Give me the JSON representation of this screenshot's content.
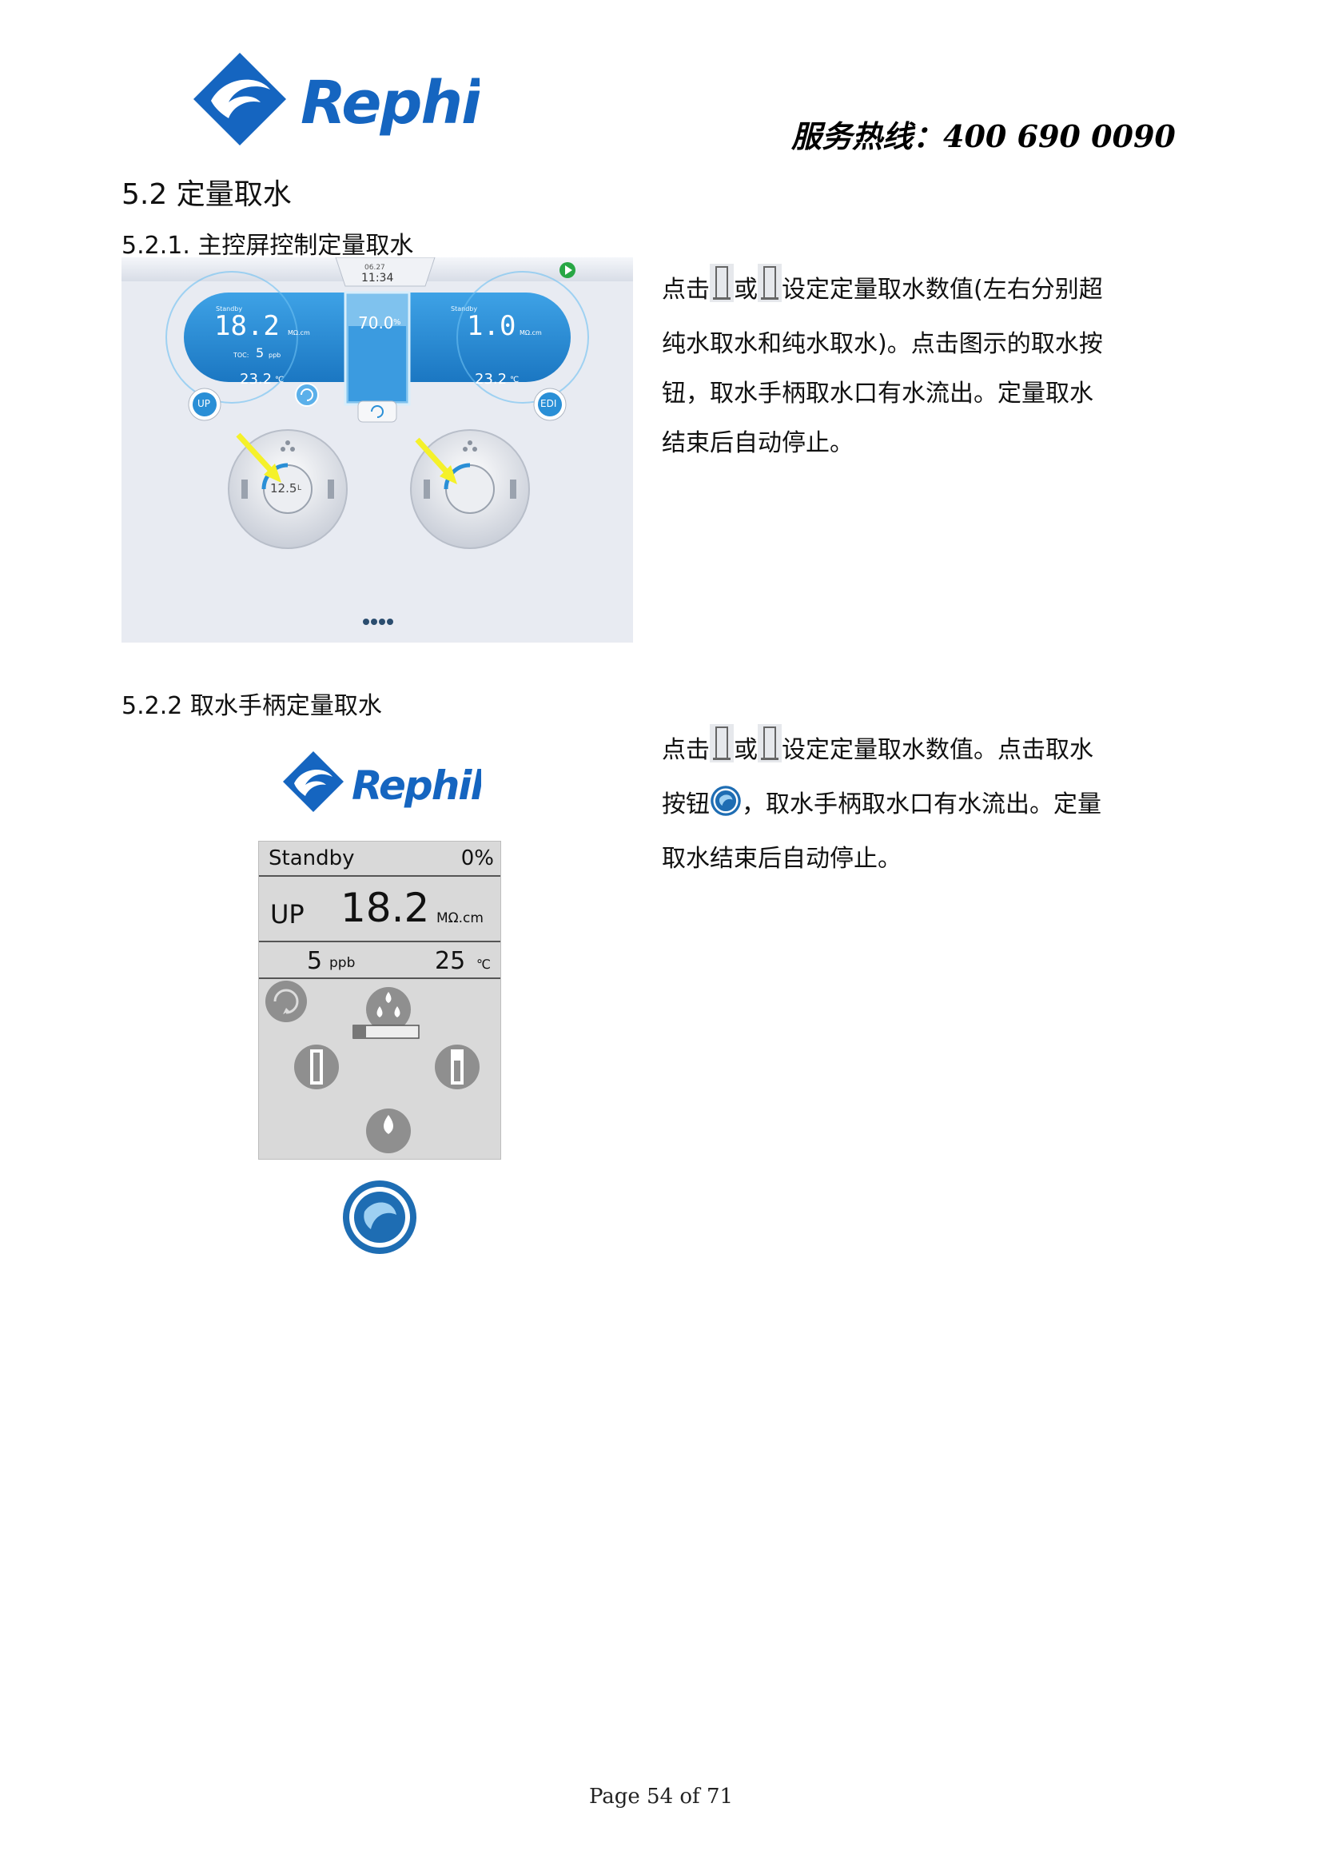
{
  "header": {
    "logo_text": "Rephile",
    "hotline": "服务热线：400  690  0090"
  },
  "section": {
    "title": "5.2  定量取水",
    "sub1_title": "5.2.1.  主控屏控制定量取水",
    "sub2_title": "5.2.2  取水手柄定量取水"
  },
  "text1": {
    "part1": "点击",
    "or": "或",
    "part2": "设定定量取水数值(左右分别超纯水取水和纯水取水)。点击图示的取水按钮，取水手柄取水口有水流出。定量取水结束后自动停止。"
  },
  "text2": {
    "part1": "点击",
    "or": "或",
    "part2": "设定定量取水数值。点击取水按钮",
    "part3": "，取水手柄取水口有水流出。定量取水结束后自动停止。"
  },
  "screen1": {
    "date": "06.27",
    "time": "11:34",
    "left_status": "Standby",
    "left_value": "18.2",
    "left_unit": "MΩ.cm",
    "toc_label": "TOC:",
    "toc_value": "5",
    "toc_unit": "ppb",
    "left_temp": "23.2",
    "left_temp_unit": "℃",
    "tank_value": "70.0",
    "tank_unit": "%",
    "right_status": "Standby",
    "right_value": "1.0",
    "right_unit": "MΩ.cm",
    "right_temp": "23.2",
    "right_temp_unit": "℃",
    "up_label": "UP",
    "edi_label": "EDI",
    "left_dial": "12.5",
    "left_dial_unit": "L"
  },
  "screen2": {
    "status": "Standby",
    "percent": "0%",
    "mode": "UP",
    "value": "18.2",
    "unit": "MΩ.cm",
    "toc_value": "5",
    "toc_unit": "ppb",
    "temp_value": "25",
    "temp_unit": "℃"
  },
  "footer": {
    "page": "Page 54 of 71"
  },
  "colors": {
    "brand_blue": "#1565c0",
    "panel_blue": "#2a8fd6",
    "arrow_yellow": "#f5f12a"
  }
}
